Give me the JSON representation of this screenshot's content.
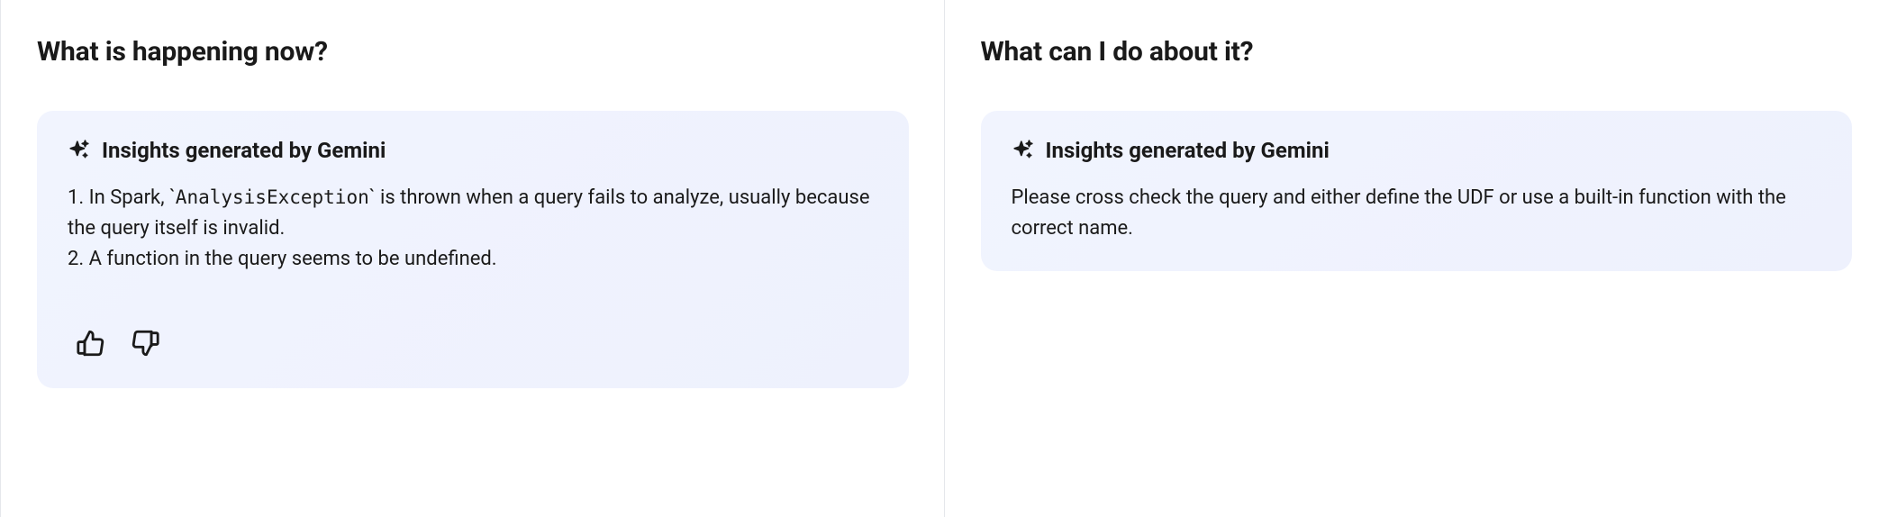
{
  "left": {
    "heading": "What is happening now?",
    "card_heading": "Insights generated by Gemini",
    "line1_prefix": "1. In Spark, `",
    "line1_code": "AnalysisException",
    "line1_suffix": "` is thrown when a query fails to analyze, usually because the query itself is invalid.",
    "line2": "2. A function in the query seems to be undefined."
  },
  "right": {
    "heading": "What can I do about it?",
    "card_heading": "Insights generated by Gemini",
    "body": "Please cross check the query and either define the UDF or use a built-in function with the correct name."
  }
}
